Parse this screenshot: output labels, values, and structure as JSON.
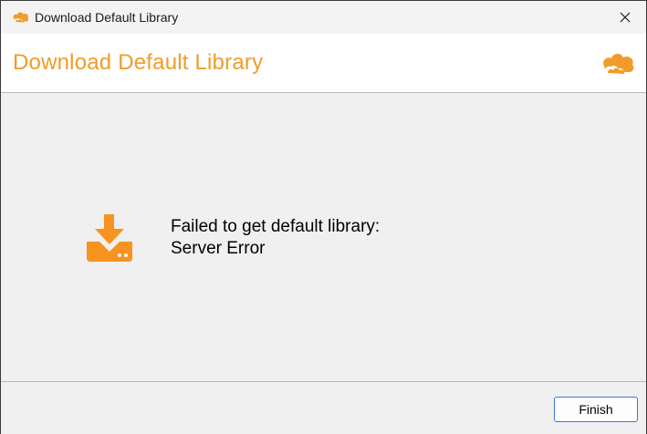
{
  "window": {
    "title": "Download Default Library",
    "icon": "seafile-cloud-icon",
    "close_icon": "close-icon"
  },
  "header": {
    "heading": "Download Default Library",
    "logo": "seafile-cloud-icon",
    "accent_color": "#f19c29"
  },
  "content": {
    "icon": "download-icon",
    "message_line1": "Failed to get default library:",
    "message_line2": "Server Error"
  },
  "footer": {
    "finish_label": "Finish"
  }
}
